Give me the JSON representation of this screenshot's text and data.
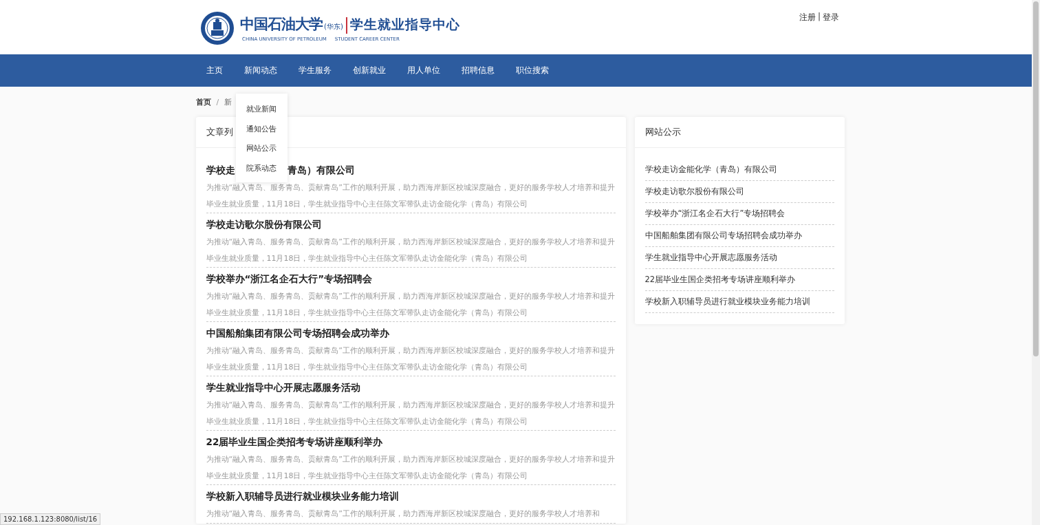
{
  "header": {
    "logo": {
      "cn_name": "中国石油大学",
      "campus": "(华东)",
      "center_name": "学生就业指导中心",
      "en_name": "CHINA UNIVERSITY OF PETROLEUM",
      "en_center": "STUDENT CAREER CENTER"
    },
    "auth": {
      "register": "注册",
      "separator": "|",
      "login": "登录"
    }
  },
  "nav": [
    {
      "label": "主页"
    },
    {
      "label": "新闻动态",
      "menu": [
        "就业新闻",
        "通知公告",
        "网站公示",
        "院系动态"
      ]
    },
    {
      "label": "学生服务"
    },
    {
      "label": "创新就业"
    },
    {
      "label": "用人单位"
    },
    {
      "label": "招聘信息"
    },
    {
      "label": "职位搜索"
    }
  ],
  "breadcrumb": {
    "separator": "/",
    "items": [
      {
        "label": "首页",
        "current": false
      },
      {
        "label": "新",
        "current": true
      }
    ]
  },
  "articles": {
    "title": "文章列",
    "items": [
      {
        "title_segments": [
          "学校走",
          "青岛）有限公司"
        ],
        "summary": "为推动“融入青岛、服务青岛、贡献青岛”工作的顺利开展，助力西海岸新区校城深度融合，更好的服务学校人才培养和提升毕业生就业质量，11月18日，学生就业指导中心主任陈文军带队走访金能化学（青岛）有限公司"
      },
      {
        "title_segments": [
          "学校走访歌尔股份有限公司"
        ],
        "summary": "为推动“融入青岛、服务青岛、贡献青岛”工作的顺利开展，助力西海岸新区校城深度融合，更好的服务学校人才培养和提升毕业生就业质量，11月18日，学生就业指导中心主任陈文军带队走访金能化学（青岛）有限公司"
      },
      {
        "title_segments": [
          "学校举办“浙江名企石大行”专场招聘会"
        ],
        "summary": "为推动“融入青岛、服务青岛、贡献青岛”工作的顺利开展，助力西海岸新区校城深度融合，更好的服务学校人才培养和提升毕业生就业质量，11月18日，学生就业指导中心主任陈文军带队走访金能化学（青岛）有限公司"
      },
      {
        "title_segments": [
          "中国船舶集团有限公司专场招聘会成功举办"
        ],
        "summary": "为推动“融入青岛、服务青岛、贡献青岛”工作的顺利开展，助力西海岸新区校城深度融合，更好的服务学校人才培养和提升毕业生就业质量，11月18日，学生就业指导中心主任陈文军带队走访金能化学（青岛）有限公司"
      },
      {
        "title_segments": [
          "学生就业指导中心开展志愿服务活动"
        ],
        "summary": "为推动“融入青岛、服务青岛、贡献青岛”工作的顺利开展，助力西海岸新区校城深度融合，更好的服务学校人才培养和提升毕业生就业质量，11月18日，学生就业指导中心主任陈文军带队走访金能化学（青岛）有限公司"
      },
      {
        "title_segments": [
          "22届毕业生国企类招考专场讲座顺利举办"
        ],
        "summary": "为推动“融入青岛、服务青岛、贡献青岛”工作的顺利开展，助力西海岸新区校城深度融合，更好的服务学校人才培养和提升毕业生就业质量，11月18日，学生就业指导中心主任陈文军带队走访金能化学（青岛）有限公司"
      },
      {
        "title_segments": [
          "学校新入职辅导员进行就业模块业务能力培训"
        ],
        "summary": "为推动“融入青岛、服务青岛、贡献青岛”工作的顺利开展，助力西海岸新区校城深度融合，更好的服务学校人才培养和"
      }
    ]
  },
  "sidebar": {
    "title": "网站公示",
    "items": [
      "学校走访金能化学（青岛）有限公司",
      "学校走访歌尔股份有限公司",
      "学校举办“浙江名企石大行”专场招聘会",
      "中国船舶集团有限公司专场招聘会成功举办",
      "学生就业指导中心开展志愿服务活动",
      "22届毕业生国企类招考专场讲座顺利举办",
      "学校新入职辅导员进行就业模块业务能力培训"
    ]
  },
  "status_url": "192.168.1.123:8080/list/16"
}
